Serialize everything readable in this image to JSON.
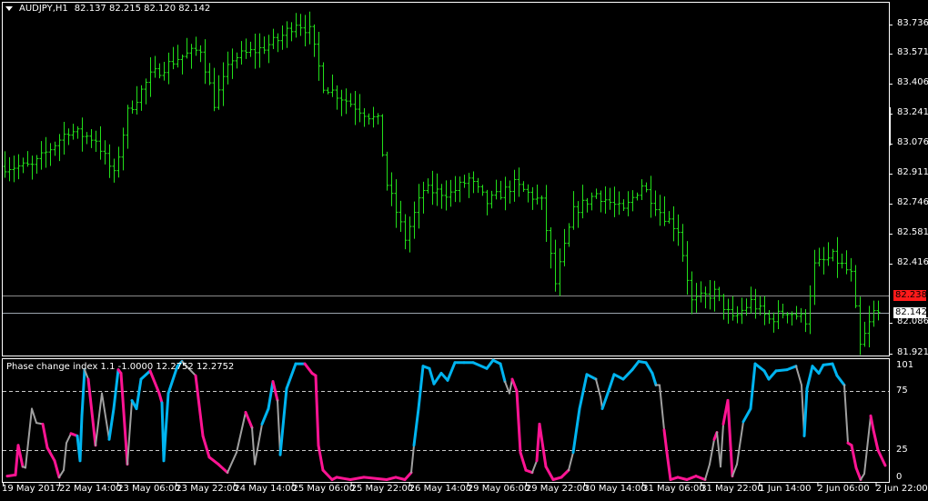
{
  "header": {
    "symbol": "AUDJPY,H1",
    "ohlc": "82.137 82.215 82.120 82.142"
  },
  "indicator": {
    "title": "Phase change index 1.1 -1.0000 12.2752 12.2752",
    "levels": [
      "101",
      "75",
      "25",
      "0"
    ]
  },
  "colors": {
    "bars": "#22e01a",
    "up": "#00b4f0",
    "down": "#ff1493",
    "neutral": "#a0a0a0",
    "grid": "#c8c8c8",
    "ask": "#ff1a1a"
  },
  "price_axis": [
    "83.736",
    "83.571",
    "83.406",
    "83.241",
    "83.076",
    "82.911",
    "82.746",
    "82.581",
    "82.416",
    "82.086",
    "81.921"
  ],
  "price_markers": {
    "ask": "82.238",
    "bid": "82.142"
  },
  "time_axis": [
    "19 May 2017",
    "22 May 14:00",
    "23 May 06:00",
    "23 May 22:00",
    "24 May 14:00",
    "25 May 06:00",
    "25 May 22:00",
    "26 May 14:00",
    "29 May 06:00",
    "29 May 22:00",
    "30 May 14:00",
    "31 May 06:00",
    "31 May 22:00",
    "1 Jun 14:00",
    "2 Jun 06:00",
    "2 Jun 22:00"
  ],
  "chart_data": [
    {
      "type": "ohlc",
      "name": "AUDJPY H1",
      "bar_count": 193,
      "ylim": [
        81.921,
        83.736
      ],
      "path": [
        [
          0,
          82.95
        ],
        [
          6,
          82.95
        ],
        [
          14,
          83.15
        ],
        [
          20,
          83.1
        ],
        [
          24,
          82.9
        ],
        [
          27,
          83.25
        ],
        [
          32,
          83.45
        ],
        [
          38,
          83.55
        ],
        [
          43,
          83.6
        ],
        [
          46,
          83.3
        ],
        [
          50,
          83.55
        ],
        [
          56,
          83.6
        ],
        [
          60,
          83.65
        ],
        [
          64,
          83.75
        ],
        [
          67,
          83.7
        ],
        [
          70,
          83.4
        ],
        [
          76,
          83.3
        ],
        [
          82,
          83.2
        ],
        [
          84,
          82.85
        ],
        [
          88,
          82.55
        ],
        [
          92,
          82.82
        ],
        [
          98,
          82.8
        ],
        [
          102,
          82.88
        ],
        [
          106,
          82.75
        ],
        [
          112,
          82.85
        ],
        [
          118,
          82.75
        ],
        [
          121,
          82.3
        ],
        [
          125,
          82.7
        ],
        [
          130,
          82.8
        ],
        [
          136,
          82.7
        ],
        [
          140,
          82.85
        ],
        [
          144,
          82.7
        ],
        [
          148,
          82.6
        ],
        [
          151,
          82.2
        ],
        [
          156,
          82.25
        ],
        [
          160,
          82.1
        ],
        [
          164,
          82.2
        ],
        [
          168,
          82.1
        ],
        [
          172,
          82.15
        ],
        [
          176,
          82.1
        ],
        [
          178,
          82.4
        ],
        [
          182,
          82.45
        ],
        [
          186,
          82.35
        ],
        [
          188,
          81.95
        ],
        [
          191,
          82.14
        ],
        [
          192,
          82.142
        ]
      ]
    },
    {
      "type": "line",
      "name": "Phase change index",
      "ylim": [
        0,
        101
      ],
      "points": [
        [
          0.6,
          3,
          "p"
        ],
        [
          2.4,
          4,
          "p"
        ],
        [
          3,
          29,
          "p"
        ],
        [
          4,
          11,
          "p"
        ],
        [
          4.6,
          10,
          "g"
        ],
        [
          6,
          60,
          "g"
        ],
        [
          7,
          48,
          "g"
        ],
        [
          8.4,
          47,
          "g"
        ],
        [
          9.4,
          27,
          "p"
        ],
        [
          11,
          16,
          "p"
        ],
        [
          12,
          2,
          "p"
        ],
        [
          13,
          8,
          "g"
        ],
        [
          13.6,
          31,
          "g"
        ],
        [
          14.6,
          39,
          "g"
        ],
        [
          16,
          37,
          "p"
        ],
        [
          16.6,
          16,
          "b"
        ],
        [
          17,
          54,
          "b"
        ],
        [
          17.6,
          93,
          "b"
        ],
        [
          18.4,
          85,
          "g"
        ],
        [
          20,
          29,
          "p"
        ],
        [
          21.4,
          73,
          "g"
        ],
        [
          23,
          34,
          "g"
        ],
        [
          24,
          60,
          "b"
        ],
        [
          25,
          93,
          "b"
        ],
        [
          25.6,
          90,
          "p"
        ],
        [
          27,
          13,
          "p"
        ],
        [
          28,
          67,
          "g"
        ],
        [
          29,
          60,
          "b"
        ],
        [
          30,
          85,
          "b"
        ],
        [
          32,
          92,
          "b"
        ],
        [
          34,
          73,
          "p"
        ],
        [
          34.6,
          65,
          "p"
        ],
        [
          35,
          16,
          "b"
        ],
        [
          36,
          73,
          "b"
        ],
        [
          38,
          96,
          "b"
        ],
        [
          39,
          100,
          "b"
        ],
        [
          42,
          88,
          "g"
        ],
        [
          43.6,
          37,
          "p"
        ],
        [
          45,
          19,
          "p"
        ],
        [
          47,
          13,
          "p"
        ],
        [
          49,
          6,
          "p"
        ],
        [
          51,
          23,
          "g"
        ],
        [
          53,
          57,
          "g"
        ],
        [
          54.4,
          44,
          "p"
        ],
        [
          55,
          13,
          "g"
        ],
        [
          56.6,
          47,
          "g"
        ],
        [
          58,
          60,
          "b"
        ],
        [
          59,
          83,
          "b"
        ],
        [
          60,
          67,
          "p"
        ],
        [
          60.6,
          21,
          "g"
        ],
        [
          62,
          77,
          "b"
        ],
        [
          64,
          98,
          "b"
        ],
        [
          66,
          98,
          "b"
        ],
        [
          67.6,
          90,
          "p"
        ],
        [
          68.4,
          88,
          "p"
        ],
        [
          69,
          29,
          "p"
        ],
        [
          70,
          8,
          "p"
        ],
        [
          72,
          0,
          "p"
        ],
        [
          73,
          2,
          "p"
        ],
        [
          76,
          0,
          "p"
        ],
        [
          79,
          2,
          "p"
        ],
        [
          84,
          0,
          "p"
        ],
        [
          86,
          2,
          "p"
        ],
        [
          88,
          0,
          "p"
        ],
        [
          89.4,
          6,
          "p"
        ],
        [
          90,
          29,
          "g"
        ],
        [
          91,
          60,
          "b"
        ],
        [
          92,
          96,
          "b"
        ],
        [
          93.4,
          94,
          "b"
        ],
        [
          94.4,
          81,
          "b"
        ],
        [
          96,
          90,
          "b"
        ],
        [
          97.4,
          84,
          "b"
        ],
        [
          99,
          99,
          "b"
        ],
        [
          101,
          99,
          "b"
        ],
        [
          103,
          99,
          "b"
        ],
        [
          106,
          94,
          "b"
        ],
        [
          107.4,
          101,
          "b"
        ],
        [
          109,
          98,
          "b"
        ],
        [
          110,
          83,
          "b"
        ],
        [
          111,
          73,
          "g"
        ],
        [
          111.6,
          85,
          "g"
        ],
        [
          112.6,
          75,
          "p"
        ],
        [
          113.4,
          23,
          "p"
        ],
        [
          114.6,
          8,
          "p"
        ],
        [
          116,
          6,
          "p"
        ],
        [
          117,
          16,
          "g"
        ],
        [
          117.6,
          47,
          "p"
        ],
        [
          119,
          11,
          "p"
        ],
        [
          120.6,
          0,
          "p"
        ],
        [
          122.4,
          2,
          "p"
        ],
        [
          124,
          8,
          "p"
        ],
        [
          125,
          23,
          "g"
        ],
        [
          126.4,
          60,
          "b"
        ],
        [
          128,
          89,
          "b"
        ],
        [
          130,
          85,
          "b"
        ],
        [
          131,
          70,
          "g"
        ],
        [
          131.4,
          60,
          "g"
        ],
        [
          132.6,
          73,
          "b"
        ],
        [
          134,
          89,
          "b"
        ],
        [
          136,
          85,
          "b"
        ],
        [
          138,
          93,
          "b"
        ],
        [
          139.4,
          100,
          "b"
        ],
        [
          141,
          99,
          "b"
        ],
        [
          142.4,
          90,
          "b"
        ],
        [
          143.2,
          80,
          "b"
        ],
        [
          144,
          80,
          "g"
        ],
        [
          145,
          42,
          "g"
        ],
        [
          145.6,
          23,
          "p"
        ],
        [
          146.4,
          0,
          "p"
        ],
        [
          148,
          2,
          "p"
        ],
        [
          150,
          0,
          "p"
        ],
        [
          152,
          3,
          "p"
        ],
        [
          154,
          0,
          "p"
        ],
        [
          155,
          13,
          "g"
        ],
        [
          156,
          34,
          "g"
        ],
        [
          156.6,
          40,
          "p"
        ],
        [
          157.4,
          11,
          "g"
        ],
        [
          158,
          47,
          "g"
        ],
        [
          159,
          67,
          "p"
        ],
        [
          160,
          3,
          "p"
        ],
        [
          161,
          13,
          "g"
        ],
        [
          162.4,
          49,
          "g"
        ],
        [
          164,
          60,
          "b"
        ],
        [
          165,
          98,
          "b"
        ],
        [
          167,
          92,
          "b"
        ],
        [
          168,
          85,
          "b"
        ],
        [
          169.6,
          92,
          "b"
        ],
        [
          172,
          93,
          "b"
        ],
        [
          174,
          96,
          "b"
        ],
        [
          175.2,
          80,
          "g"
        ],
        [
          175.8,
          37,
          "g"
        ],
        [
          176.4,
          77,
          "b"
        ],
        [
          177.6,
          96,
          "b"
        ],
        [
          179,
          90,
          "b"
        ],
        [
          180,
          97,
          "b"
        ],
        [
          182,
          98,
          "b"
        ],
        [
          183,
          88,
          "b"
        ],
        [
          184.6,
          80,
          "b"
        ],
        [
          185.4,
          31,
          "g"
        ],
        [
          186.2,
          29,
          "p"
        ],
        [
          187.2,
          10,
          "p"
        ],
        [
          188.2,
          0,
          "p"
        ],
        [
          189,
          5,
          "g"
        ],
        [
          190.4,
          54,
          "g"
        ],
        [
          191,
          42,
          "p"
        ],
        [
          192,
          25,
          "p"
        ],
        [
          193.6,
          12,
          "p"
        ]
      ]
    }
  ]
}
